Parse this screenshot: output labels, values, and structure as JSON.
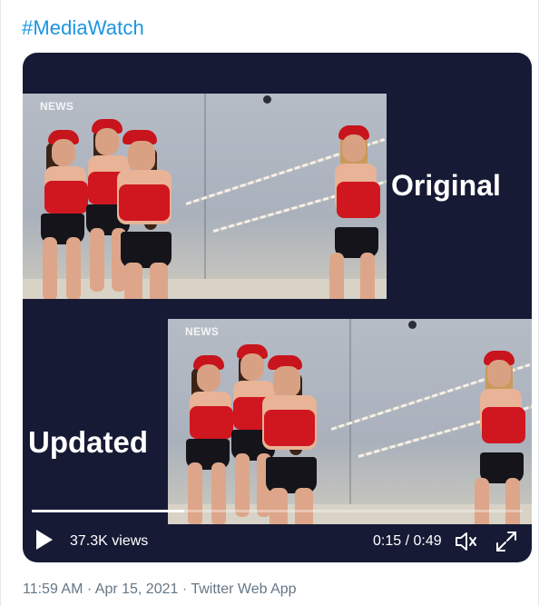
{
  "tweet": {
    "hashtag": "#MediaWatch",
    "meta": {
      "time": "11:59 AM",
      "separator": " · ",
      "date": "Apr 15, 2021",
      "source": "Twitter Web App"
    }
  },
  "video": {
    "label_top": "Original",
    "label_bottom": "Updated",
    "watermark": "NEWS",
    "views": "37.3K views",
    "time": "0:15 / 0:49",
    "progress_fraction": 0.31,
    "colors": {
      "background": "#161a35",
      "accent_hat": "#c8141c",
      "link": "#1b95e0"
    },
    "icons": [
      "play-icon",
      "volume-icon",
      "fullscreen-icon"
    ]
  }
}
